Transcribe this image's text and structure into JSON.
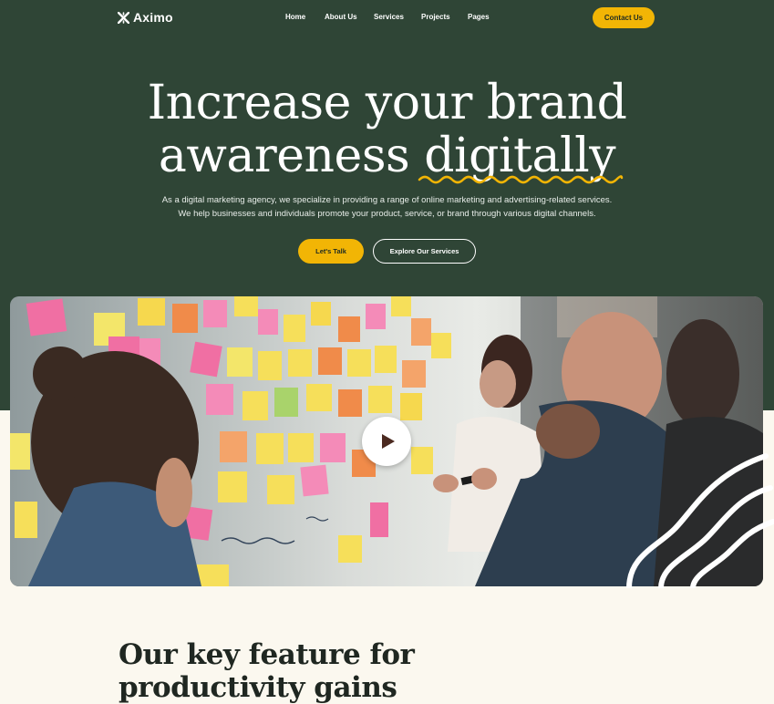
{
  "brand": {
    "name": "Aximo",
    "icon": "x-cross-icon"
  },
  "nav": {
    "items": [
      {
        "label": "Home"
      },
      {
        "label": "About Us"
      },
      {
        "label": "Services"
      },
      {
        "label": "Projects"
      },
      {
        "label": "Pages"
      }
    ],
    "contact_label": "Contact Us"
  },
  "hero": {
    "headline_line1": "Increase your brand",
    "headline_line2_prefix": "awareness ",
    "headline_line2_highlight": "digitally",
    "subtitle_line1": "As a digital marketing agency, we specialize in providing a range of online marketing and advertising-related services.",
    "subtitle_line2": "We help businesses and individuals promote your product, service, or brand through various digital channels.",
    "primary_cta": "Let's Talk",
    "secondary_cta": "Explore Our Services",
    "video_play_icon": "play-icon"
  },
  "features": {
    "title_line1": "Our key feature for",
    "title_line2": "productivity gains"
  },
  "colors": {
    "hero_bg": "#2f4536",
    "accent": "#f2b505",
    "page_bg": "#fbf8ef",
    "heading_dark": "#1f2721"
  }
}
